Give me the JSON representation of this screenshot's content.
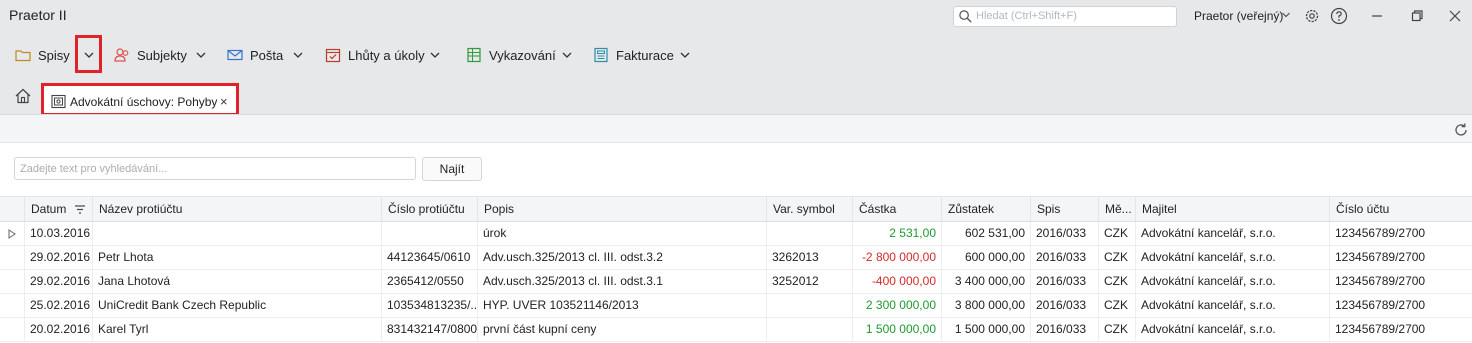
{
  "app": {
    "title": "Praetor II"
  },
  "titlebar": {
    "search_placeholder": "Hledat (Ctrl+Shift+F)",
    "profile": "Praetor (veřejný)"
  },
  "menus": [
    {
      "label": "Spisy",
      "icon": "folder-icon"
    },
    {
      "label": "Subjekty",
      "icon": "people-icon"
    },
    {
      "label": "Pošta",
      "icon": "envelope-icon"
    },
    {
      "label": "Lhůty a úkoly",
      "icon": "calendar-check-icon"
    },
    {
      "label": "Vykazování",
      "icon": "spreadsheet-icon"
    },
    {
      "label": "Fakturace",
      "icon": "invoice-icon"
    }
  ],
  "tab": {
    "label": "Advokátní úschovy: Pohyby",
    "close": "×"
  },
  "search": {
    "placeholder": "Zadejte text pro vyhledávání...",
    "button": "Najít"
  },
  "colors": {
    "accent_red": "#e0232a",
    "positive": "#1f9a2f",
    "negative": "#d42a2a"
  },
  "grid": {
    "columns": [
      "Datum",
      "Název protiúčtu",
      "Číslo protiúčtu",
      "Popis",
      "Var. symbol",
      "Částka",
      "Zůstatek",
      "Spis",
      "Mě...",
      "Majitel",
      "Číslo účtu"
    ],
    "rows": [
      [
        "10.03.2016",
        "",
        "",
        "úrok",
        "",
        "2 531,00",
        "602 531,00",
        "2016/033",
        "CZK",
        "Advokátní kancelář, s.r.o.",
        "123456789/2700"
      ],
      [
        "29.02.2016",
        "Petr Lhota",
        "44123645/0610",
        "Adv.usch.325/2013 cl. III. odst.3.2",
        "3262013",
        "-2 800 000,00",
        "600 000,00",
        "2016/033",
        "CZK",
        "Advokátní kancelář, s.r.o.",
        "123456789/2700"
      ],
      [
        "29.02.2016",
        "Jana Lhotová",
        "2365412/0550",
        "Adv.usch.325/2013 cl. III. odst.3.1",
        "3252012",
        "-400 000,00",
        "3 400 000,00",
        "2016/033",
        "CZK",
        "Advokátní kancelář, s.r.o.",
        "123456789/2700"
      ],
      [
        "25.02.2016",
        "UniCredit Bank Czech Republic",
        "103534813235/...",
        "HYP. UVER 103521146/2013",
        "",
        "2 300 000,00",
        "3 800 000,00",
        "2016/033",
        "CZK",
        "Advokátní kancelář, s.r.o.",
        "123456789/2700"
      ],
      [
        "20.02.2016",
        "Karel Tyrl",
        "831432147/0800",
        "první část kupní ceny",
        "",
        "1 500 000,00",
        "1 500 000,00",
        "2016/033",
        "CZK",
        "Advokátní kancelář, s.r.o.",
        "123456789/2700"
      ]
    ]
  }
}
